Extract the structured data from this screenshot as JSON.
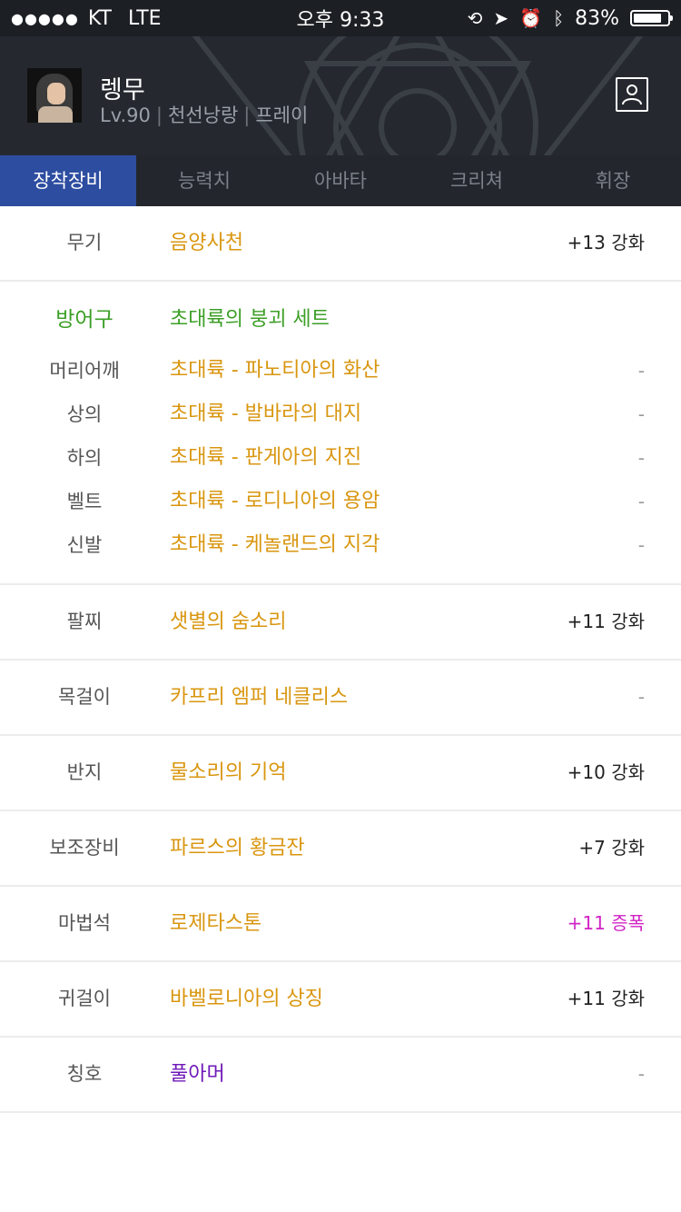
{
  "status_bar": {
    "carrier": "KT",
    "network": "LTE",
    "time": "오후 9:33",
    "battery": "83%",
    "battery_level": 0.83
  },
  "profile": {
    "name": "렝무",
    "level": "Lv.90",
    "job": "천선낭랑",
    "server": "프레이"
  },
  "tabs": [
    {
      "label": "장착장비",
      "active": true
    },
    {
      "label": "능력치",
      "active": false
    },
    {
      "label": "아바타",
      "active": false
    },
    {
      "label": "크리쳐",
      "active": false
    },
    {
      "label": "휘장",
      "active": false
    }
  ],
  "equipment": {
    "weapon": {
      "label": "무기",
      "item": "음양사천",
      "value": "+13 강화"
    },
    "armor": {
      "label": "방어구",
      "set_name": "초대륙의 붕괴 세트",
      "parts": [
        {
          "label": "머리어깨",
          "item": "초대륙 - 파노티아의 화산",
          "value": "-"
        },
        {
          "label": "상의",
          "item": "초대륙 - 발바라의 대지",
          "value": "-"
        },
        {
          "label": "하의",
          "item": "초대륙 - 판게아의 지진",
          "value": "-"
        },
        {
          "label": "벨트",
          "item": "초대륙 - 로디니아의 용암",
          "value": "-"
        },
        {
          "label": "신발",
          "item": "초대륙 - 케놀랜드의 지각",
          "value": "-"
        }
      ]
    },
    "bracelet": {
      "label": "팔찌",
      "item": "샛별의 숨소리",
      "value": "+11 강화"
    },
    "necklace": {
      "label": "목걸이",
      "item": "카프리 엠퍼 네클리스",
      "value": "-"
    },
    "ring": {
      "label": "반지",
      "item": "물소리의 기억",
      "value": "+10 강화"
    },
    "subequip": {
      "label": "보조장비",
      "item": "파르스의 황금잔",
      "value": "+7 강화"
    },
    "magicstone": {
      "label": "마법석",
      "item": "로제타스톤",
      "value": "+11 증폭"
    },
    "earring": {
      "label": "귀걸이",
      "item": "바벨로니아의 상징",
      "value": "+11 강화"
    },
    "title": {
      "label": "칭호",
      "item": "풀아머",
      "value": "-"
    }
  },
  "colors": {
    "tab_active": "#2d4da0",
    "item_rare": "#d9960f",
    "set": "#3b9f25",
    "amplify": "#d124c5",
    "title_item": "#6f19b8"
  }
}
